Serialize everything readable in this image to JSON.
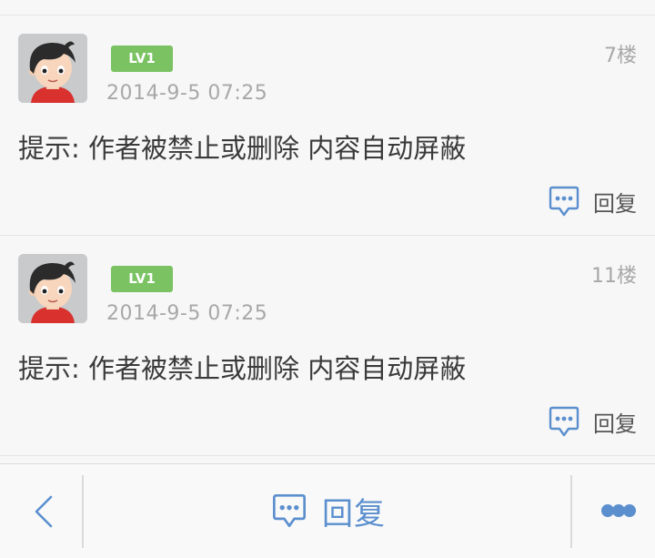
{
  "posts": [
    {
      "level": "LV1",
      "time": "2014-9-5 07:25",
      "floor": "7楼",
      "content": "提示: 作者被禁止或删除 内容自动屏蔽",
      "reply_label": "回复"
    },
    {
      "level": "LV1",
      "time": "2014-9-5 07:25",
      "floor": "11楼",
      "content": "提示: 作者被禁止或删除 内容自动屏蔽",
      "reply_label": "回复"
    }
  ],
  "bottom_bar": {
    "back_icon": "chevron-left-icon",
    "reply_icon": "chat-bubble-icon",
    "reply_label": "回复",
    "more_icon": "more-dots-icon"
  },
  "colors": {
    "level_badge": "#7ac262",
    "accent_blue": "#5b8fce",
    "muted_text": "#a8a8a8",
    "body_text": "#3a3a3a"
  }
}
